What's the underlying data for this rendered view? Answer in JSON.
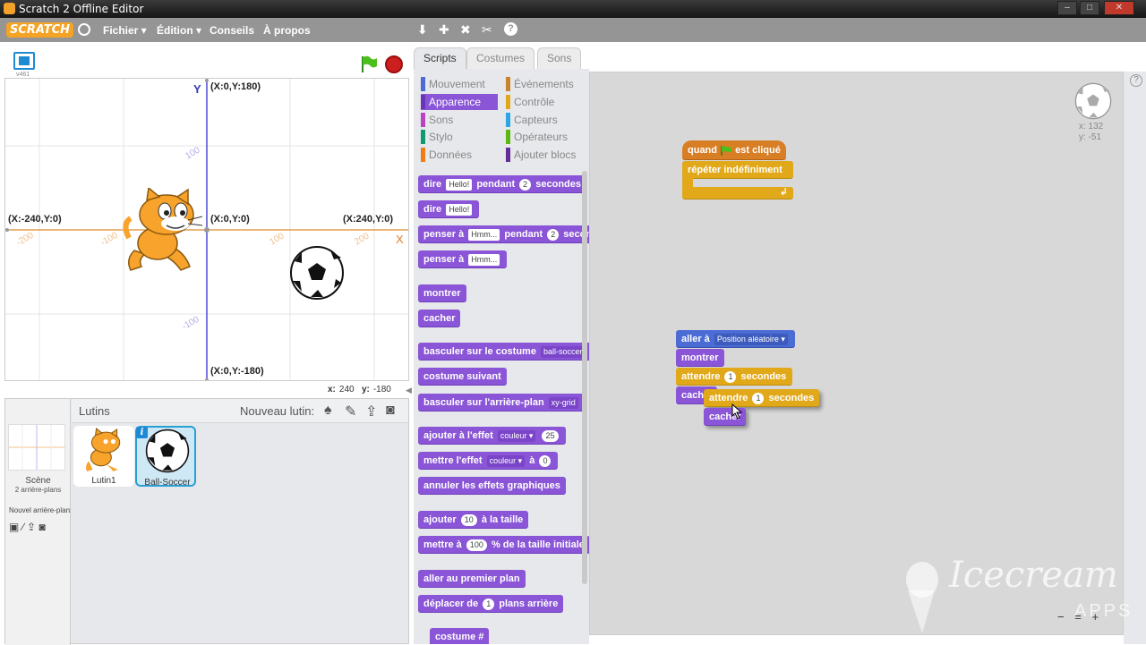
{
  "window": {
    "title": "Scratch 2 Offline Editor",
    "minimize": "–",
    "maximize": "□",
    "close": "✕"
  },
  "menu": {
    "logo": "SCRATCH",
    "items": [
      "Fichier ▾",
      "Édition ▾",
      "Conseils",
      "À propos"
    ],
    "tools": [
      "stamp-icon",
      "grow-icon",
      "shrink-icon",
      "scissors-icon",
      "help-icon"
    ]
  },
  "stage": {
    "version": "v461",
    "labels": {
      "y_axis": "Y",
      "x_axis": "X",
      "top": "(X:0,Y:180)",
      "left": "(X:-240,Y:0)",
      "center": "(X:0,Y:0)",
      "right": "(X:240,Y:0)",
      "bottom": "(X:0,Y:-180)",
      "tick_x_neg200": "-200",
      "tick_x_neg100": "-100",
      "tick_x_100": "100",
      "tick_x_200": "200",
      "tick_y_100": "100",
      "tick_y_neg100": "-100"
    },
    "mouse_x_label": "x:",
    "mouse_x": "240",
    "mouse_y_label": "y:",
    "mouse_y": "-180"
  },
  "sprites": {
    "title": "Lutins",
    "new_sprite": "Nouveau lutin:",
    "scene_label": "Scène",
    "scene_sub": "2 arrière-plans",
    "new_backdrop": "Nouvel arrière-plan:",
    "items": [
      {
        "name": "Lutin1"
      },
      {
        "name": "Ball-Soccer"
      }
    ],
    "info": "i"
  },
  "tabs": [
    "Scripts",
    "Costumes",
    "Sons"
  ],
  "categories": [
    {
      "label": "Mouvement",
      "color": "#4a6cd4"
    },
    {
      "label": "Apparence",
      "color": "#8a55d7"
    },
    {
      "label": "Sons",
      "color": "#bb42c3"
    },
    {
      "label": "Stylo",
      "color": "#0e9a6c"
    },
    {
      "label": "Données",
      "color": "#ee7d16"
    },
    {
      "label": "Événements",
      "color": "#c88330"
    },
    {
      "label": "Contrôle",
      "color": "#e1a91a"
    },
    {
      "label": "Capteurs",
      "color": "#2ca5e2"
    },
    {
      "label": "Opérateurs",
      "color": "#5cb712"
    },
    {
      "label": "Ajouter blocs",
      "color": "#632d99"
    }
  ],
  "palette": {
    "say_secs": {
      "a": "dire",
      "in1": "Hello!",
      "b": "pendant",
      "n": "2",
      "c": "secondes"
    },
    "say": {
      "a": "dire",
      "in1": "Hello!"
    },
    "think_secs": {
      "a": "penser à",
      "in1": "Hmm...",
      "b": "pendant",
      "n": "2",
      "c": "secondes"
    },
    "think": {
      "a": "penser à",
      "in1": "Hmm..."
    },
    "show": "montrer",
    "hide": "cacher",
    "switch_costume": {
      "a": "basculer sur le costume",
      "dd": "ball-soccer"
    },
    "next_costume": "costume suivant",
    "switch_backdrop": {
      "a": "basculer sur l'arrière-plan",
      "dd": "xy-grid"
    },
    "change_effect": {
      "a": "ajouter à l'effet",
      "dd": "couleur ▾",
      "n": "25"
    },
    "set_effect": {
      "a": "mettre l'effet",
      "dd": "couleur ▾",
      "b": "à",
      "n": "0"
    },
    "clear_effects": "annuler les effets graphiques",
    "change_size": {
      "a": "ajouter",
      "n": "10",
      "b": "à la taille"
    },
    "set_size": {
      "a": "mettre à",
      "n": "100",
      "b": "% de la taille initiale"
    },
    "front": "aller au premier plan",
    "back": {
      "a": "déplacer de",
      "n": "1",
      "b": "plans arrière"
    },
    "costume_num": "costume #"
  },
  "scripts": {
    "when_flag": {
      "a": "quand",
      "b": "est cliqué"
    },
    "forever": "répéter indéfiniment",
    "goto": {
      "a": "aller à",
      "dd": "Position aléatoire ▾"
    },
    "show": "montrer",
    "wait1": {
      "a": "attendre",
      "n": "1",
      "b": "secondes"
    },
    "hide1": "cacher",
    "wait2": {
      "a": "attendre",
      "n": "1",
      "b": "secondes"
    },
    "hide2": "cacher"
  },
  "sprite_info": {
    "x": "x: 132",
    "y": "y: -51"
  },
  "zoom": {
    "out": "−",
    "reset": "=",
    "in": "+"
  },
  "watermark": {
    "text": "Icecream",
    "sub": "APPS"
  }
}
